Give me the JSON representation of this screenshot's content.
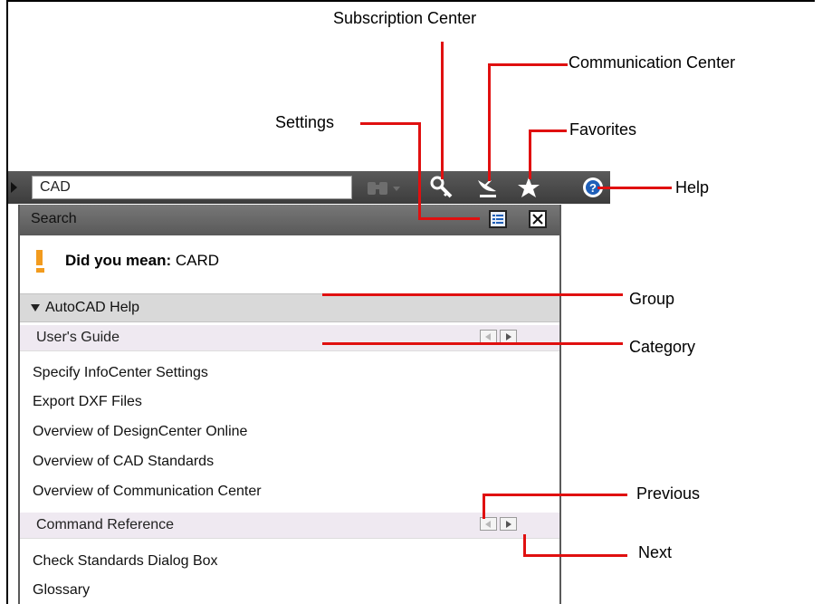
{
  "callouts": {
    "subscription_center": "Subscription Center",
    "communication_center": "Communication Center",
    "settings": "Settings",
    "favorites": "Favorites",
    "help": "Help",
    "group": "Group",
    "category": "Category",
    "previous": "Previous",
    "next": "Next"
  },
  "toolbar": {
    "search_value": "CAD",
    "icons": [
      "binoculars-icon",
      "key-icon",
      "satellite-dish-icon",
      "star-icon",
      "help-icon"
    ]
  },
  "panel": {
    "header_title": "Search",
    "did_you_mean_prefix": "Did you mean:",
    "did_you_mean_term": "CARD",
    "group_label": "AutoCAD Help",
    "categories": [
      {
        "label": "User's Guide",
        "results": [
          "Specify InfoCenter Settings",
          "Export DXF Files",
          "Overview of DesignCenter Online",
          "Overview of CAD Standards",
          "Overview of Communication Center"
        ]
      },
      {
        "label": "Command Reference",
        "results": [
          "Check Standards Dialog Box",
          "Glossary"
        ]
      }
    ]
  },
  "colors": {
    "callout_line": "#e01010",
    "toolbar_bg": "#4a4a4a",
    "group_bg": "#d9d9d9",
    "category_bg": "#efe9f1",
    "warning": "#f29b1e"
  }
}
